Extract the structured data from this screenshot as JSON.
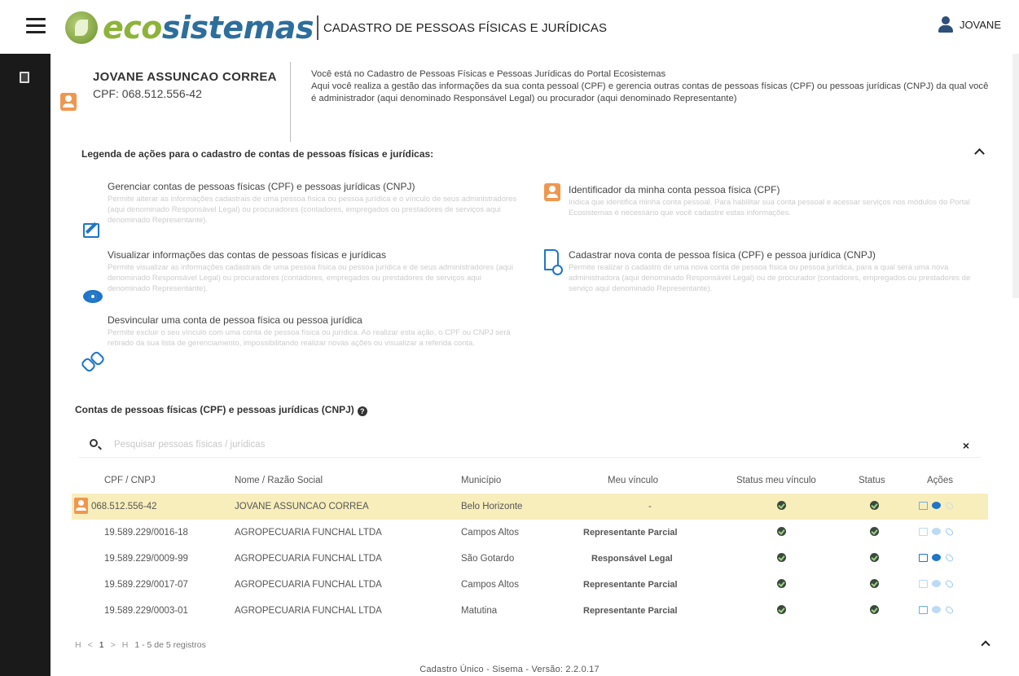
{
  "header": {
    "logo_eco": "eco",
    "logo_sis": "sistemas",
    "subtitle": "CADASTRO DE PESSOAS FÍSICAS E JURÍDICAS",
    "user_name": "JOVANE"
  },
  "profile": {
    "name": "JOVANE ASSUNCAO CORREA",
    "cpf": "CPF: 068.512.556-42"
  },
  "intro": {
    "line1": "Você está no Cadastro de Pessoas Físicas e Pessoas Jurídicas do Portal Ecosistemas",
    "line2": "Aqui você realiza a gestão das informações da sua conta pessoal (CPF) e gerencia outras contas de pessoas físicas (CPF) ou pessoas jurídicas (CNPJ) da qual você é administrador (aqui denominado Responsável Legal) ou procurador (aqui denominado Representante)"
  },
  "legend": {
    "title": "Legenda de ações para o cadastro de contas de pessoas físicas e jurídicas:",
    "items": [
      {
        "title": "Gerenciar contas de pessoas físicas (CPF) e pessoas jurídicas (CNPJ)",
        "desc": "Permite alterar as informações cadastrais de uma pessoa física ou pessoa jurídica e o vínculo de seus administradores (aqui denominado Responsável Legal) ou procuradores (contadores, empregados ou prestadores de serviços aqui denominado Representante).",
        "icon": "edit-icon"
      },
      {
        "title": "Visualizar informações das contas de pessoas físicas e jurídicas",
        "desc": "Permite visualizar as informações cadastrais de uma pessoa física ou pessoa jurídica e de seus administradores (aqui denominado Responsável Legal) ou procuradores (contadores, empregados ou prestadores de serviços aqui denominado Representante).",
        "icon": "eye-icon"
      },
      {
        "title": "Desvincular uma conta de pessoa física ou pessoa jurídica",
        "desc": "Permite excluir o seu vínculo com uma conta de pessoa física ou jurídica. Ao realizar esta ação, o CPF ou CNPJ será retirado da sua lista de gerenciamento, impossibilitando realizar novas ações ou visualizar a referida conta.",
        "icon": "unlink-icon"
      },
      {
        "title": "Identificador da minha conta pessoa física (CPF)",
        "desc": "Indica que identifica minha conta pessoal. Para habilitar sua conta pessoal e acessar serviços nos módulos do Portal Ecosistemas é necessário que você cadastre estas informações.",
        "icon": "person-icon"
      },
      {
        "title": "Cadastrar nova conta de pessoa física (CPF) e pessoa jurídica (CNPJ)",
        "desc": "Permite realizar o cadastro de uma nova conta de pessoa física ou pessoa jurídica, para a qual será uma nova administradora (aqui denominado Responsável Legal) ou de procurador (contadores, empregados ou prestadores de serviço aqui denominado Representante).",
        "icon": "document-icon"
      }
    ]
  },
  "accounts": {
    "title": "Contas de pessoas físicas (CPF) e pessoas jurídicas (CNPJ)",
    "search_placeholder": "Pesquisar pessoas físicas / jurídicas",
    "columns": [
      "CPF / CNPJ",
      "Nome / Razão Social",
      "Município",
      "Meu vínculo",
      "Status meu vínculo",
      "Status",
      "Ações"
    ],
    "rows": [
      {
        "doc": "068.512.556-42",
        "name": "JOVANE ASSUNCAO CORREA",
        "city": "Belo Horizonte",
        "link": "-",
        "own": true
      },
      {
        "doc": "19.589.229/0016-18",
        "name": "AGROPECUARIA FUNCHAL LTDA",
        "city": "Campos Altos",
        "link": "Representante Parcial",
        "own": false
      },
      {
        "doc": "19.589.229/0009-99",
        "name": "AGROPECUARIA FUNCHAL LTDA",
        "city": "São Gotardo",
        "link": "Responsável Legal",
        "own": false
      },
      {
        "doc": "19.589.229/0017-07",
        "name": "AGROPECUARIA FUNCHAL LTDA",
        "city": "Campos Altos",
        "link": "Representante Parcial",
        "own": false
      },
      {
        "doc": "19.589.229/0003-01",
        "name": "AGROPECUARIA FUNCHAL LTDA",
        "city": "Matutina",
        "link": "Representante Parcial",
        "own": false
      }
    ]
  },
  "pagination": {
    "first": "H",
    "prev": "<",
    "page": "1",
    "next": ">",
    "last": "H",
    "summary": "1 - 5 de 5 registros"
  },
  "footer": {
    "text": "Cadastro Único - Sisema - Versão: 2.2.0.17"
  },
  "colors": {
    "brand_green": "#8db33a",
    "brand_blue": "#2d6e9c",
    "accent_orange": "#f0974e",
    "highlight_row": "#f8eebc",
    "sidebar": "#1a1a1a"
  }
}
